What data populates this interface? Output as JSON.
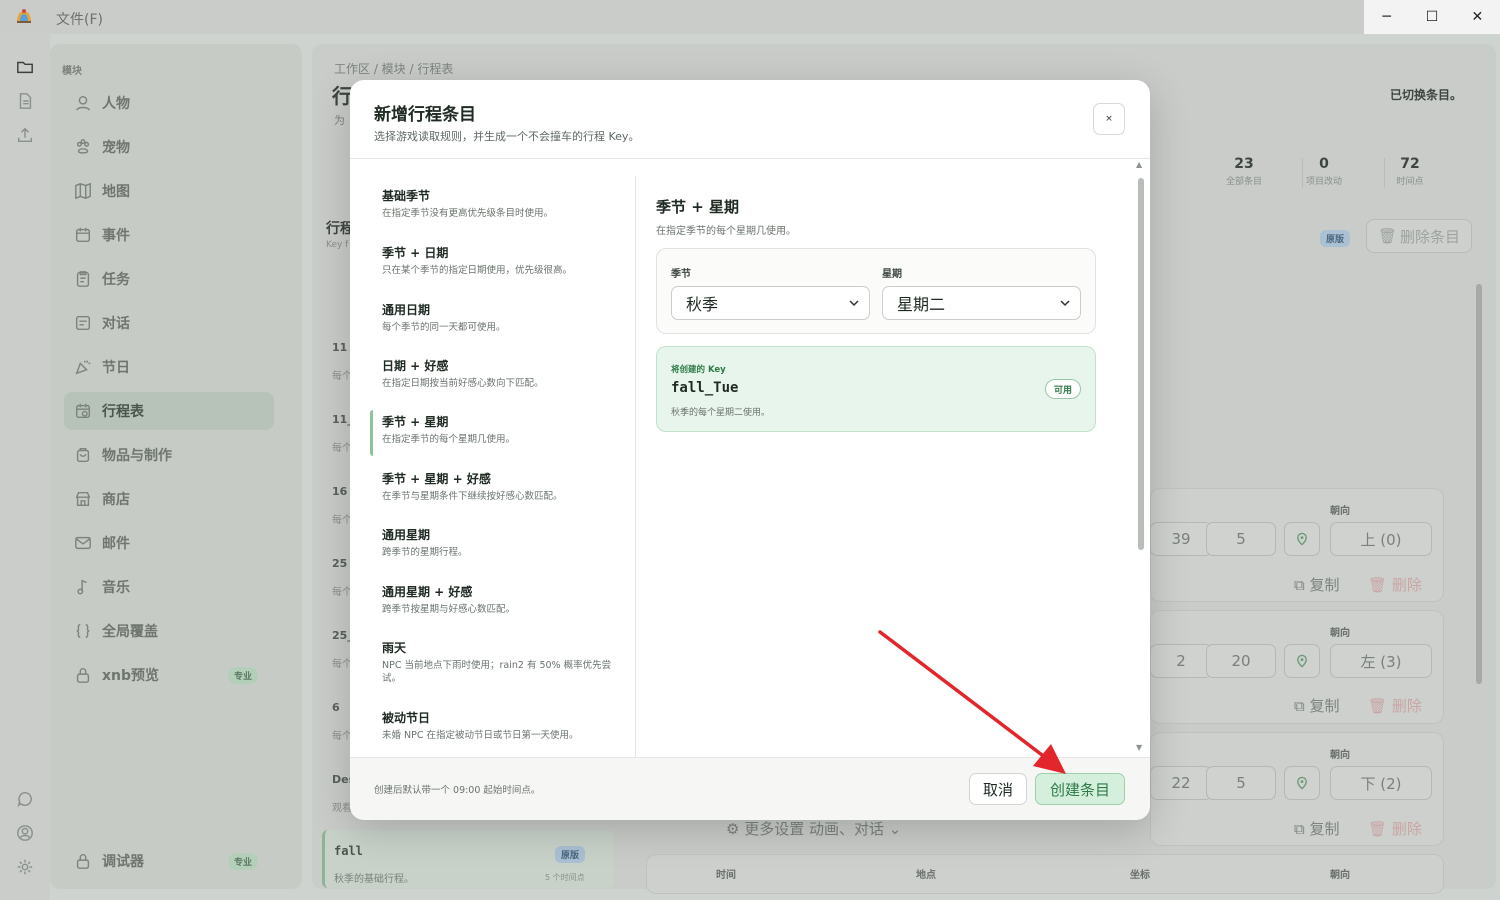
{
  "titlebar": {
    "menu_file": "文件(F)",
    "minimize": "─",
    "maximize": "☐",
    "close": "✕"
  },
  "sidebar": {
    "section": "模块",
    "items": [
      {
        "label": "人物",
        "icon": "user-icon"
      },
      {
        "label": "宠物",
        "icon": "paw-icon"
      },
      {
        "label": "地图",
        "icon": "map-icon"
      },
      {
        "label": "事件",
        "icon": "calendar-icon"
      },
      {
        "label": "任务",
        "icon": "clipboard-icon"
      },
      {
        "label": "对话",
        "icon": "dialog-icon"
      },
      {
        "label": "节日",
        "icon": "party-icon"
      },
      {
        "label": "行程表",
        "icon": "schedule-icon",
        "active": true
      },
      {
        "label": "物品与制作",
        "icon": "bag-icon"
      },
      {
        "label": "商店",
        "icon": "store-icon"
      },
      {
        "label": "邮件",
        "icon": "mail-icon"
      },
      {
        "label": "音乐",
        "icon": "music-icon"
      },
      {
        "label": "全局覆盖",
        "icon": "braces-icon"
      },
      {
        "label": "xnb预览",
        "icon": "lock-icon",
        "badge": "专业"
      }
    ],
    "debugger": {
      "label": "调试器",
      "badge": "专业"
    }
  },
  "background": {
    "breadcrumb": "工作区 / 模块 / 行程表",
    "title_partial": "行",
    "subtitle_partial": "为",
    "toast": "已切换条目。",
    "stats": [
      {
        "num": "23",
        "label": "全部条目"
      },
      {
        "num": "0",
        "label": "项目改动"
      },
      {
        "num": "72",
        "label": "时间点"
      }
    ],
    "original_badge": "原版",
    "delete_entry": "删除条目",
    "list_title_partial": "行程",
    "list_sub_partial": "Key f",
    "list_items": [
      "11",
      "11_",
      "16",
      "25",
      "25_",
      "6",
      "Des"
    ],
    "list_sub": "每个",
    "list_sub_last": "观看",
    "fall_card": {
      "title": "fall",
      "desc": "秋季的基础行程。",
      "meta": "5 个时间点",
      "badge": "原版"
    },
    "rows": [
      {
        "a": "39",
        "b": "5",
        "dir": "上 (0)"
      },
      {
        "a": "2",
        "b": "20",
        "dir": "左 (3)"
      },
      {
        "a": "22",
        "b": "5",
        "dir": "下 (2)"
      }
    ],
    "dir_label": "朝向",
    "copy": "复制",
    "delete": "删除",
    "more_settings": "更多设置 动画、对话",
    "table_head": [
      "时间",
      "地点",
      "坐标",
      "朝向"
    ]
  },
  "modal": {
    "title": "新增行程条目",
    "subtitle": "选择游戏读取规则，并生成一个不会撞车的行程 Key。",
    "close": "×",
    "rules": [
      {
        "title": "基础季节",
        "desc": "在指定季节没有更高优先级条目时使用。"
      },
      {
        "title": "季节 + 日期",
        "desc": "只在某个季节的指定日期使用，优先级很高。"
      },
      {
        "title": "通用日期",
        "desc": "每个季节的同一天都可使用。"
      },
      {
        "title": "日期 + 好感",
        "desc": "在指定日期按当前好感心数向下匹配。"
      },
      {
        "title": "季节 + 星期",
        "desc": "在指定季节的每个星期几使用。"
      },
      {
        "title": "季节 + 星期 + 好感",
        "desc": "在季节与星期条件下继续按好感心数匹配。"
      },
      {
        "title": "通用星期",
        "desc": "跨季节的星期行程。"
      },
      {
        "title": "通用星期 + 好感",
        "desc": "跨季节按星期与好感心数匹配。"
      },
      {
        "title": "雨天",
        "desc": "NPC 当前地点下雨时使用；rain2 有 50% 概率优先尝试。"
      },
      {
        "title": "被动节日",
        "desc": "未婚 NPC 在指定被动节日或节日第一天使用。"
      }
    ],
    "detail": {
      "title": "季节 + 星期",
      "desc": "在指定季节的每个星期几使用。",
      "season_label": "季节",
      "season_value": "秋季",
      "weekday_label": "星期",
      "weekday_value": "星期二"
    },
    "key": {
      "label": "将创建的 Key",
      "value": "fall_Tue",
      "status": "可用",
      "note": "秋季的每个星期二使用。"
    },
    "footer": {
      "note": "创建后默认带一个 09:00 起始时间点。",
      "cancel": "取消",
      "create": "创建条目"
    }
  },
  "colors": {
    "accent_green": "#2f7a47",
    "create_bg": "#d4efdc",
    "arrow": "#e2262b"
  }
}
